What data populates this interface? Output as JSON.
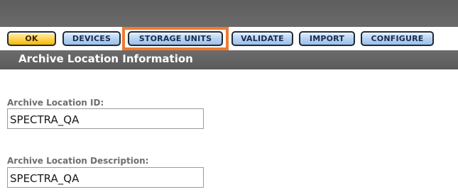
{
  "toolbar": {
    "buttons": [
      {
        "label": "OK"
      },
      {
        "label": "DEVICES"
      },
      {
        "label": "STORAGE UNITS"
      },
      {
        "label": "VALIDATE"
      },
      {
        "label": "IMPORT"
      },
      {
        "label": "CONFIGURE"
      }
    ]
  },
  "section": {
    "title": "Archive Location Information"
  },
  "form": {
    "archive_location_id": {
      "label": "Archive Location ID:",
      "value": "SPECTRA_QA"
    },
    "archive_location_description": {
      "label": "Archive Location Description:",
      "value": "SPECTRA_QA"
    }
  },
  "colors": {
    "highlight": "#f07a30",
    "header_bg": "#5f5f5f",
    "ok_button": "#f5b800",
    "nav_button": "#b8d3f2"
  }
}
